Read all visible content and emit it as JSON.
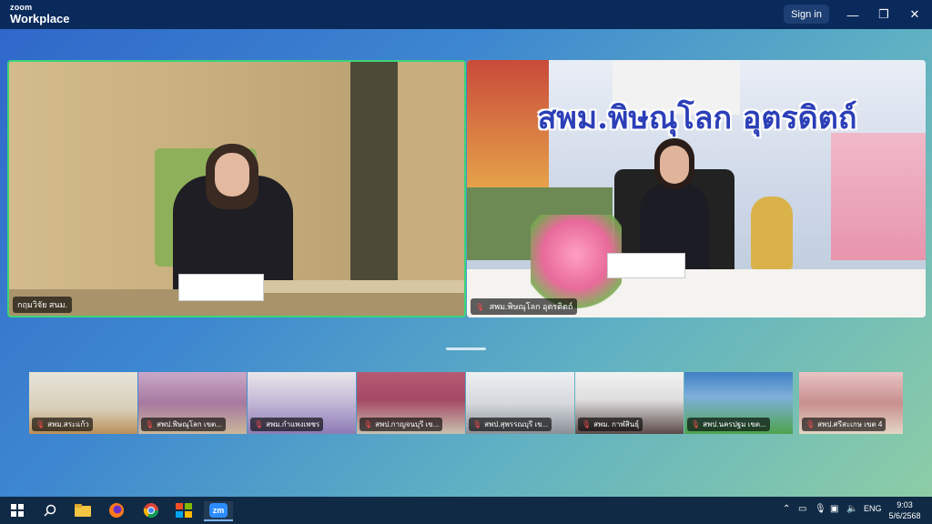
{
  "app": {
    "logo_small": "zoom",
    "logo_big": "Workplace",
    "sign_in_label": "Sign in"
  },
  "window_controls": {
    "minimize": "—",
    "maximize": "❐",
    "close": "✕"
  },
  "main_tiles": [
    {
      "name": "กฤมวิจัย สนม.",
      "active_speaker": true
    },
    {
      "name": "สพม.พิษณุโลก อุตรดิตถ์",
      "banner_title": "สพม.พิษณุโลก อุตรดิตถ์",
      "muted": true
    }
  ],
  "thumbnails": [
    {
      "name": "สพม.สระแก้ว"
    },
    {
      "name": "สพป.พิษณุโลก เขต..."
    },
    {
      "name": "สพม.กำแพงเพชร"
    },
    {
      "name": "สพป.กาญจนบุรี เข..."
    },
    {
      "name": "สพป.สุพรรณบุรี เข..."
    },
    {
      "name": "สพม. กาฬสินธุ์"
    },
    {
      "name": "สพป.นครปฐม เขต..."
    },
    {
      "name": "สพป.ศรีสะเกษ เขต 4"
    }
  ],
  "taskbar": {
    "language": "ENG",
    "time": "9:03",
    "date": "5/6/2568",
    "zoom_app_label": "zm"
  },
  "colors": {
    "titlebar": "#0b2a5c",
    "active_speaker_border": "#3ed37a",
    "taskbar": "#102a45",
    "banner_text": "#2c3fb8"
  }
}
